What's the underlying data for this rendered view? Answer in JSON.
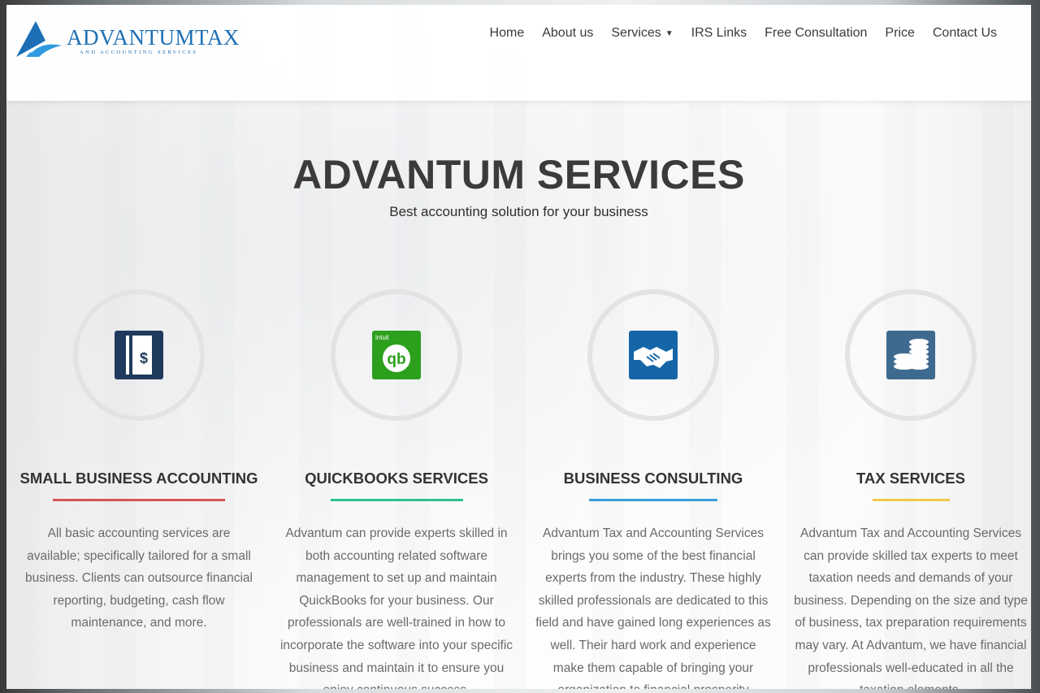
{
  "logo": {
    "name": "ADVANTUMTAX",
    "tagline": "AND ACCOUNTING SERVICES"
  },
  "nav": {
    "items": [
      "Home",
      "About us",
      "Services",
      "IRS Links",
      "Free Consultation",
      "Price",
      "Contact Us"
    ]
  },
  "hero": {
    "title": "ADVANTUM SERVICES",
    "subtitle": "Best accounting solution for your business"
  },
  "services": [
    {
      "title": "SMALL BUSINESS ACCOUNTING",
      "icon": "ledger-dollar-icon",
      "color": "#d9534f",
      "text": "All basic accounting services are available; specifically tailored for a small business. Clients can outsource financial reporting, budgeting, cash flow maintenance, and more."
    },
    {
      "title": "QUICKBOOKS SERVICES",
      "icon": "quickbooks-icon",
      "icon_label": "intuit",
      "icon_mark": "qb",
      "color": "#2ec18f",
      "text": "Advantum can provide experts skilled in both accounting related software management to set up and maintain QuickBooks for your business. Our professionals are well-trained in how to incorporate the software into your specific business and maintain it to ensure you enjoy continuous success."
    },
    {
      "title": "BUSINESS CONSULTING",
      "icon": "handshake-icon",
      "color": "#3a9dd6",
      "text": "Advantum Tax and Accounting Services brings you some of the best financial experts from the industry. These highly skilled professionals are dedicated to this field and have gained long experiences as well. Their hard work and experience make them capable of bringing your organization to financial prosperity"
    },
    {
      "title": "TAX SERVICES",
      "icon": "coin-stack-icon",
      "color": "#f1c84b",
      "text": "Advantum Tax and Accounting Services can provide skilled tax experts to meet taxation needs and demands of your business. Depending on the size and type of business, tax preparation requirements may vary. At Advantum, we have financial professionals well-educated in all the taxation elements."
    }
  ]
}
